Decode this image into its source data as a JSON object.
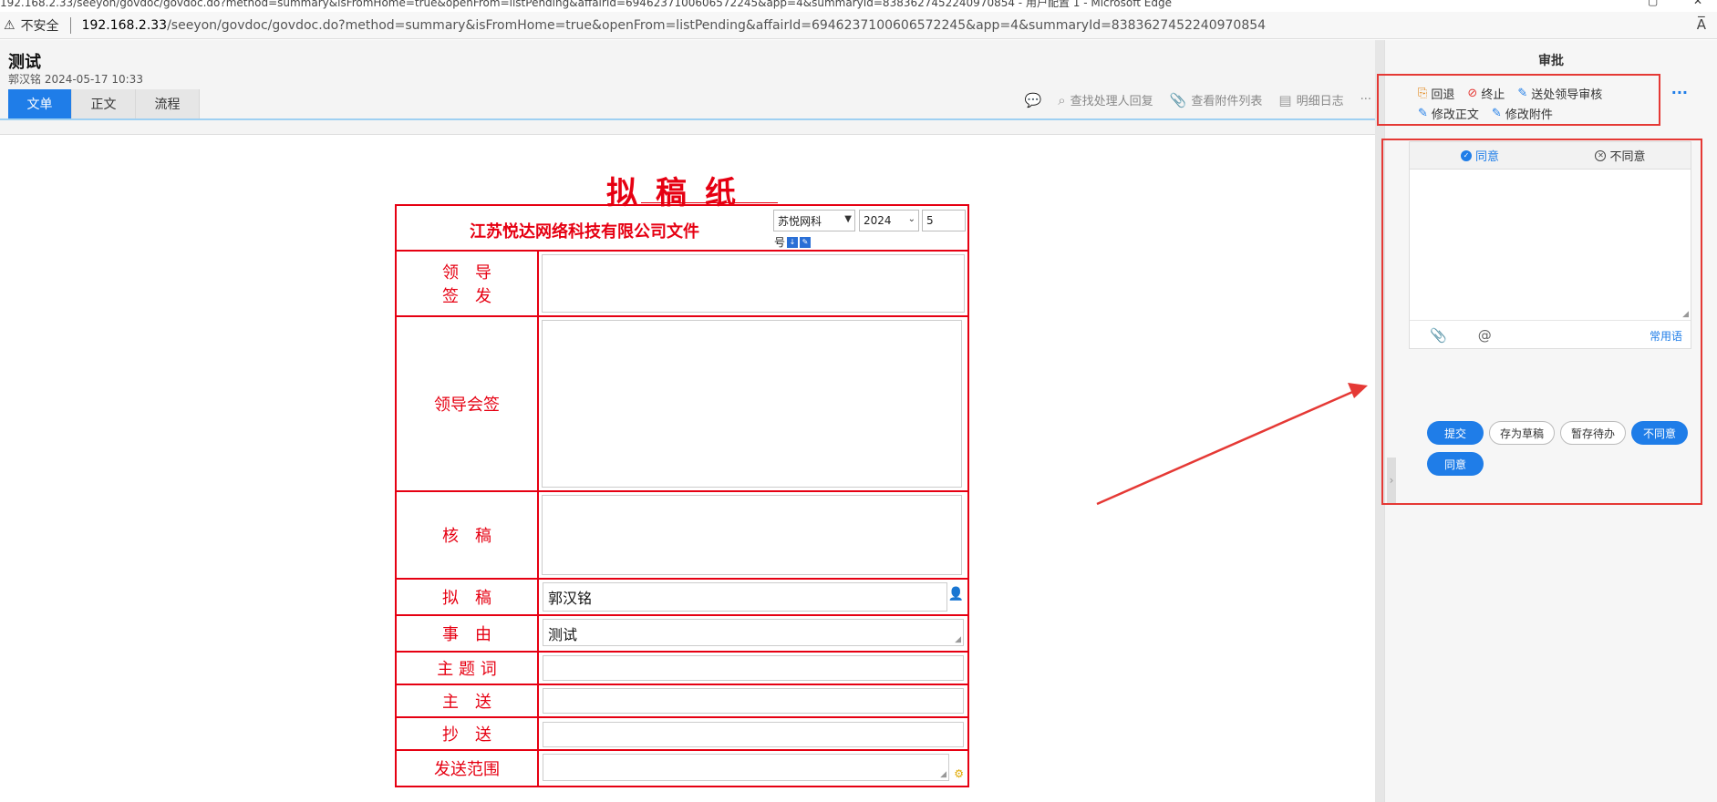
{
  "browser": {
    "window_title": "192.168.2.33/seeyon/govdoc/govdoc.do?method=summary&isFromHome=true&openFrom=listPending&affairId=6946237100606572245&app=4&summaryId=8383627452240970854 - 用户配置 1 - Microsoft Edge",
    "security_label": "不安全",
    "url_host": "192.168.2.33",
    "url_path": "/seeyon/govdoc/govdoc.do?method=summary&isFromHome=true&openFrom=listPending&affairId=6946237100606572245&app=4&summaryId=8383627452240970854",
    "reader_label": "A̅"
  },
  "document": {
    "title": "测试",
    "meta": "郭汉铭 2024-05-17 10:33",
    "tabs": [
      "文单",
      "正文",
      "流程"
    ],
    "toolbar": {
      "find_reply": "查找处理人回复",
      "attachments": "查看附件列表",
      "detail_log": "明细日志",
      "more": "···"
    }
  },
  "form": {
    "heading": "拟稿纸",
    "company": "江苏悦达网络科技有限公司文件",
    "doc_word": "苏悦网科",
    "year": "2024",
    "serial": "5",
    "hao_label": "号",
    "rows": {
      "leader_sign_1": "领　导",
      "leader_sign_2": "签　发",
      "leader_cosign": "领导会签",
      "check": "核　稿",
      "draft": "拟　稿",
      "reason": "事　由",
      "keywords": "主 题 词",
      "main_send": "主　送",
      "cc": "抄　送",
      "scope": "发送范围"
    },
    "values": {
      "drafter": "郭汉铭",
      "reason": "测试"
    }
  },
  "panel": {
    "title": "审批",
    "actions_row1": [
      "回退",
      "终止",
      "送处领导审核"
    ],
    "actions_row2": [
      "修改正文",
      "修改附件"
    ],
    "more": "···",
    "opinion_tabs": [
      "同意",
      "不同意"
    ],
    "common_phrases": "常用语",
    "buttons": [
      "提交",
      "存为草稿",
      "暂存待办",
      "不同意",
      "同意"
    ]
  },
  "colors": {
    "primary": "#1f7de8",
    "form_red": "#e60012",
    "annotation_red": "#e53935"
  }
}
